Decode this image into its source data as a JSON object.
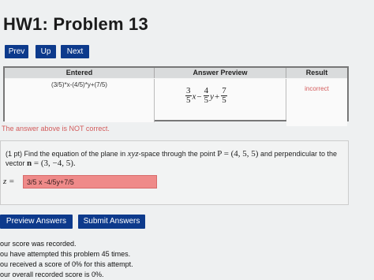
{
  "header": {
    "title": "HW1: Problem 13"
  },
  "nav": {
    "prev": "Prev",
    "up": "Up",
    "next": "Next"
  },
  "results_table": {
    "headers": [
      "Entered",
      "Answer Preview",
      "Result"
    ],
    "entered": "(3/5)*x-(4/5)*y+(7/5)",
    "preview": {
      "n1": "3",
      "d1": "5",
      "v1": "x",
      "op1": "−",
      "n2": "4",
      "d2": "5",
      "v2": "y",
      "op2": "+",
      "n3": "7",
      "d3": "5"
    },
    "result": "incorrect"
  },
  "feedback": "The answer above is NOT correct.",
  "problem": {
    "prefix": "(1 pt) Find the equation of the plane in ",
    "xyz": "xyz",
    "mid": "-space through the point ",
    "point": "P = (4, 5, 5)",
    "mid2": " and perpendicular to the vector ",
    "vec_sym": "n",
    "vec_val": " = (3, −4, 5).",
    "z_label": "z =",
    "answer_value": "3/5 x -4/5y+7/5"
  },
  "buttons": {
    "preview": "Preview Answers",
    "submit": "Submit Answers"
  },
  "status_lines": [
    "our score was recorded.",
    "ou have attempted this problem 45 times.",
    "ou received a score of 0% for this attempt.",
    "our overall recorded score is 0%."
  ],
  "colors": {
    "button_bg": "#0d3a8c",
    "error_text": "#d35b5b",
    "answer_bg": "#ef8a89"
  }
}
